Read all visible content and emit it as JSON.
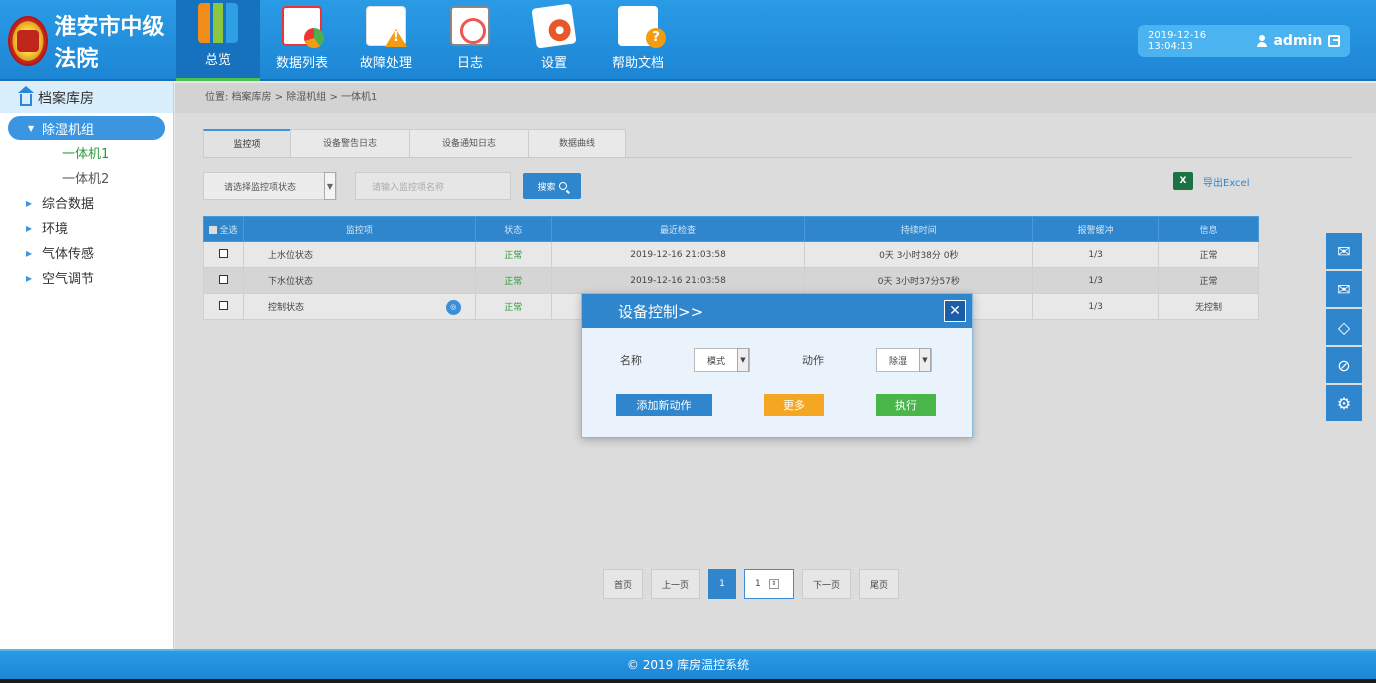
{
  "header": {
    "logo_text": "淮安市中级法院",
    "nav": [
      {
        "label": "总览",
        "icon": "overview-icon",
        "active": true
      },
      {
        "label": "数据列表",
        "icon": "data-list-icon"
      },
      {
        "label": "故障处理",
        "icon": "fault-icon"
      },
      {
        "label": "日志",
        "icon": "log-icon"
      },
      {
        "label": "设置",
        "icon": "settings-icon"
      },
      {
        "label": "帮助文档",
        "icon": "help-doc-icon"
      }
    ],
    "datetime": "2019-12-16 13:04:13",
    "username": "admin"
  },
  "sidebar": {
    "title": "档案库房",
    "group": "除湿机组",
    "subitems": [
      "一体机1",
      "一体机2"
    ],
    "items": [
      "综合数据",
      "环境",
      "气体传感",
      "空气调节"
    ]
  },
  "breadcrumb": "位置:  档案库房 > 除湿机组 > 一体机1",
  "tabs": [
    "监控项",
    "设备警告日志",
    "设备通知日志",
    "数据曲线"
  ],
  "filters": {
    "status_select": "请选择监控项状态",
    "search_placeholder": "请输入监控项名称",
    "search_label": "搜索",
    "export_label": "导出Excel"
  },
  "table": {
    "headers": [
      "全选",
      "监控项",
      "状态",
      "最近检查",
      "持续时间",
      "报警缓冲",
      "信息"
    ],
    "rows": [
      {
        "name": "上水位状态",
        "status": "正常",
        "last_check": "2019-12-16 21:03:58",
        "duration": "0天 3小时38分 0秒",
        "buffer": "1/3",
        "info": "正常"
      },
      {
        "name": "下水位状态",
        "status": "正常",
        "last_check": "2019-12-16 21:03:58",
        "duration": "0天 3小时37分57秒",
        "buffer": "1/3",
        "info": "正常"
      },
      {
        "name": "控制状态",
        "status": "正常",
        "last_check": "",
        "duration": "",
        "buffer": "1/3",
        "info": "无控制"
      }
    ]
  },
  "pager": {
    "first": "首页",
    "prev": "上一页",
    "current": "1",
    "input_value": "1",
    "next": "下一页",
    "last": "尾页"
  },
  "modal": {
    "title": "设备控制>>",
    "name_label": "名称",
    "name_value": "模式",
    "action_label": "动作",
    "action_value": "除湿",
    "add_label": "添加新动作",
    "more_label": "更多",
    "exec_label": "执行"
  },
  "footer": "© 2019  库房温控系统",
  "colors": {
    "header_blue": "#1d86d4",
    "accent_blue": "#2f86cc",
    "ok_green": "#2b9b3a",
    "orange": "#f5a623",
    "green_btn": "#49b64a"
  }
}
